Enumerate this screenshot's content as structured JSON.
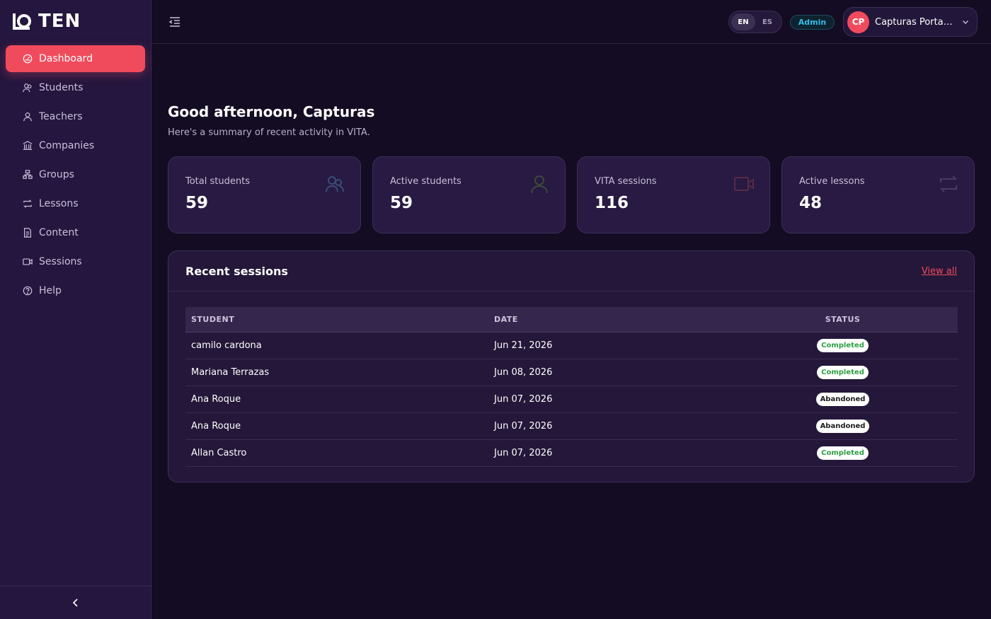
{
  "brand": {
    "name": "TEN"
  },
  "sidebar": {
    "items": [
      {
        "label": "Dashboard",
        "icon": "dashboard-icon",
        "active": true
      },
      {
        "label": "Students",
        "icon": "students-icon"
      },
      {
        "label": "Teachers",
        "icon": "teacher-icon"
      },
      {
        "label": "Companies",
        "icon": "building-icon"
      },
      {
        "label": "Groups",
        "icon": "groups-icon"
      },
      {
        "label": "Lessons",
        "icon": "repeat-icon"
      },
      {
        "label": "Content",
        "icon": "document-icon"
      },
      {
        "label": "Sessions",
        "icon": "video-icon"
      },
      {
        "label": "Help",
        "icon": "help-icon"
      }
    ]
  },
  "topbar": {
    "languages": [
      "EN",
      "ES"
    ],
    "selected_language": "EN",
    "role": "Admin",
    "user": {
      "initials": "CP",
      "name": "Capturas Portaf…"
    }
  },
  "main": {
    "greeting": "Good afternoon, Capturas",
    "subtitle": "Here's a summary of recent activity in VITA."
  },
  "stats": [
    {
      "label": "Total students",
      "value": "59",
      "icon": "students-icon"
    },
    {
      "label": "Active students",
      "value": "59",
      "icon": "user-icon"
    },
    {
      "label": "VITA sessions",
      "value": "116",
      "icon": "video-icon"
    },
    {
      "label": "Active lessons",
      "value": "48",
      "icon": "repeat-icon"
    }
  ],
  "recent_sessions": {
    "title": "Recent sessions",
    "view_all": "View all",
    "columns": [
      "STUDENT",
      "DATE",
      "STATUS"
    ],
    "rows": [
      {
        "student": "camilo cardona",
        "date": "Jun 21, 2026",
        "status": "Completed"
      },
      {
        "student": "Mariana Terrazas",
        "date": "Jun 08, 2026",
        "status": "Completed"
      },
      {
        "student": "Ana Roque",
        "date": "Jun 07, 2026",
        "status": "Abandoned"
      },
      {
        "student": "Ana Roque",
        "date": "Jun 07, 2026",
        "status": "Abandoned"
      },
      {
        "student": "Allan Castro",
        "date": "Jun 07, 2026",
        "status": "Completed"
      }
    ]
  },
  "colors": {
    "accent": "#f04b5c",
    "background": "#140c22",
    "sidebar": "#24163e",
    "card": "#281a42",
    "role_badge": "#38b8e6",
    "status_completed": "#2ea043"
  }
}
